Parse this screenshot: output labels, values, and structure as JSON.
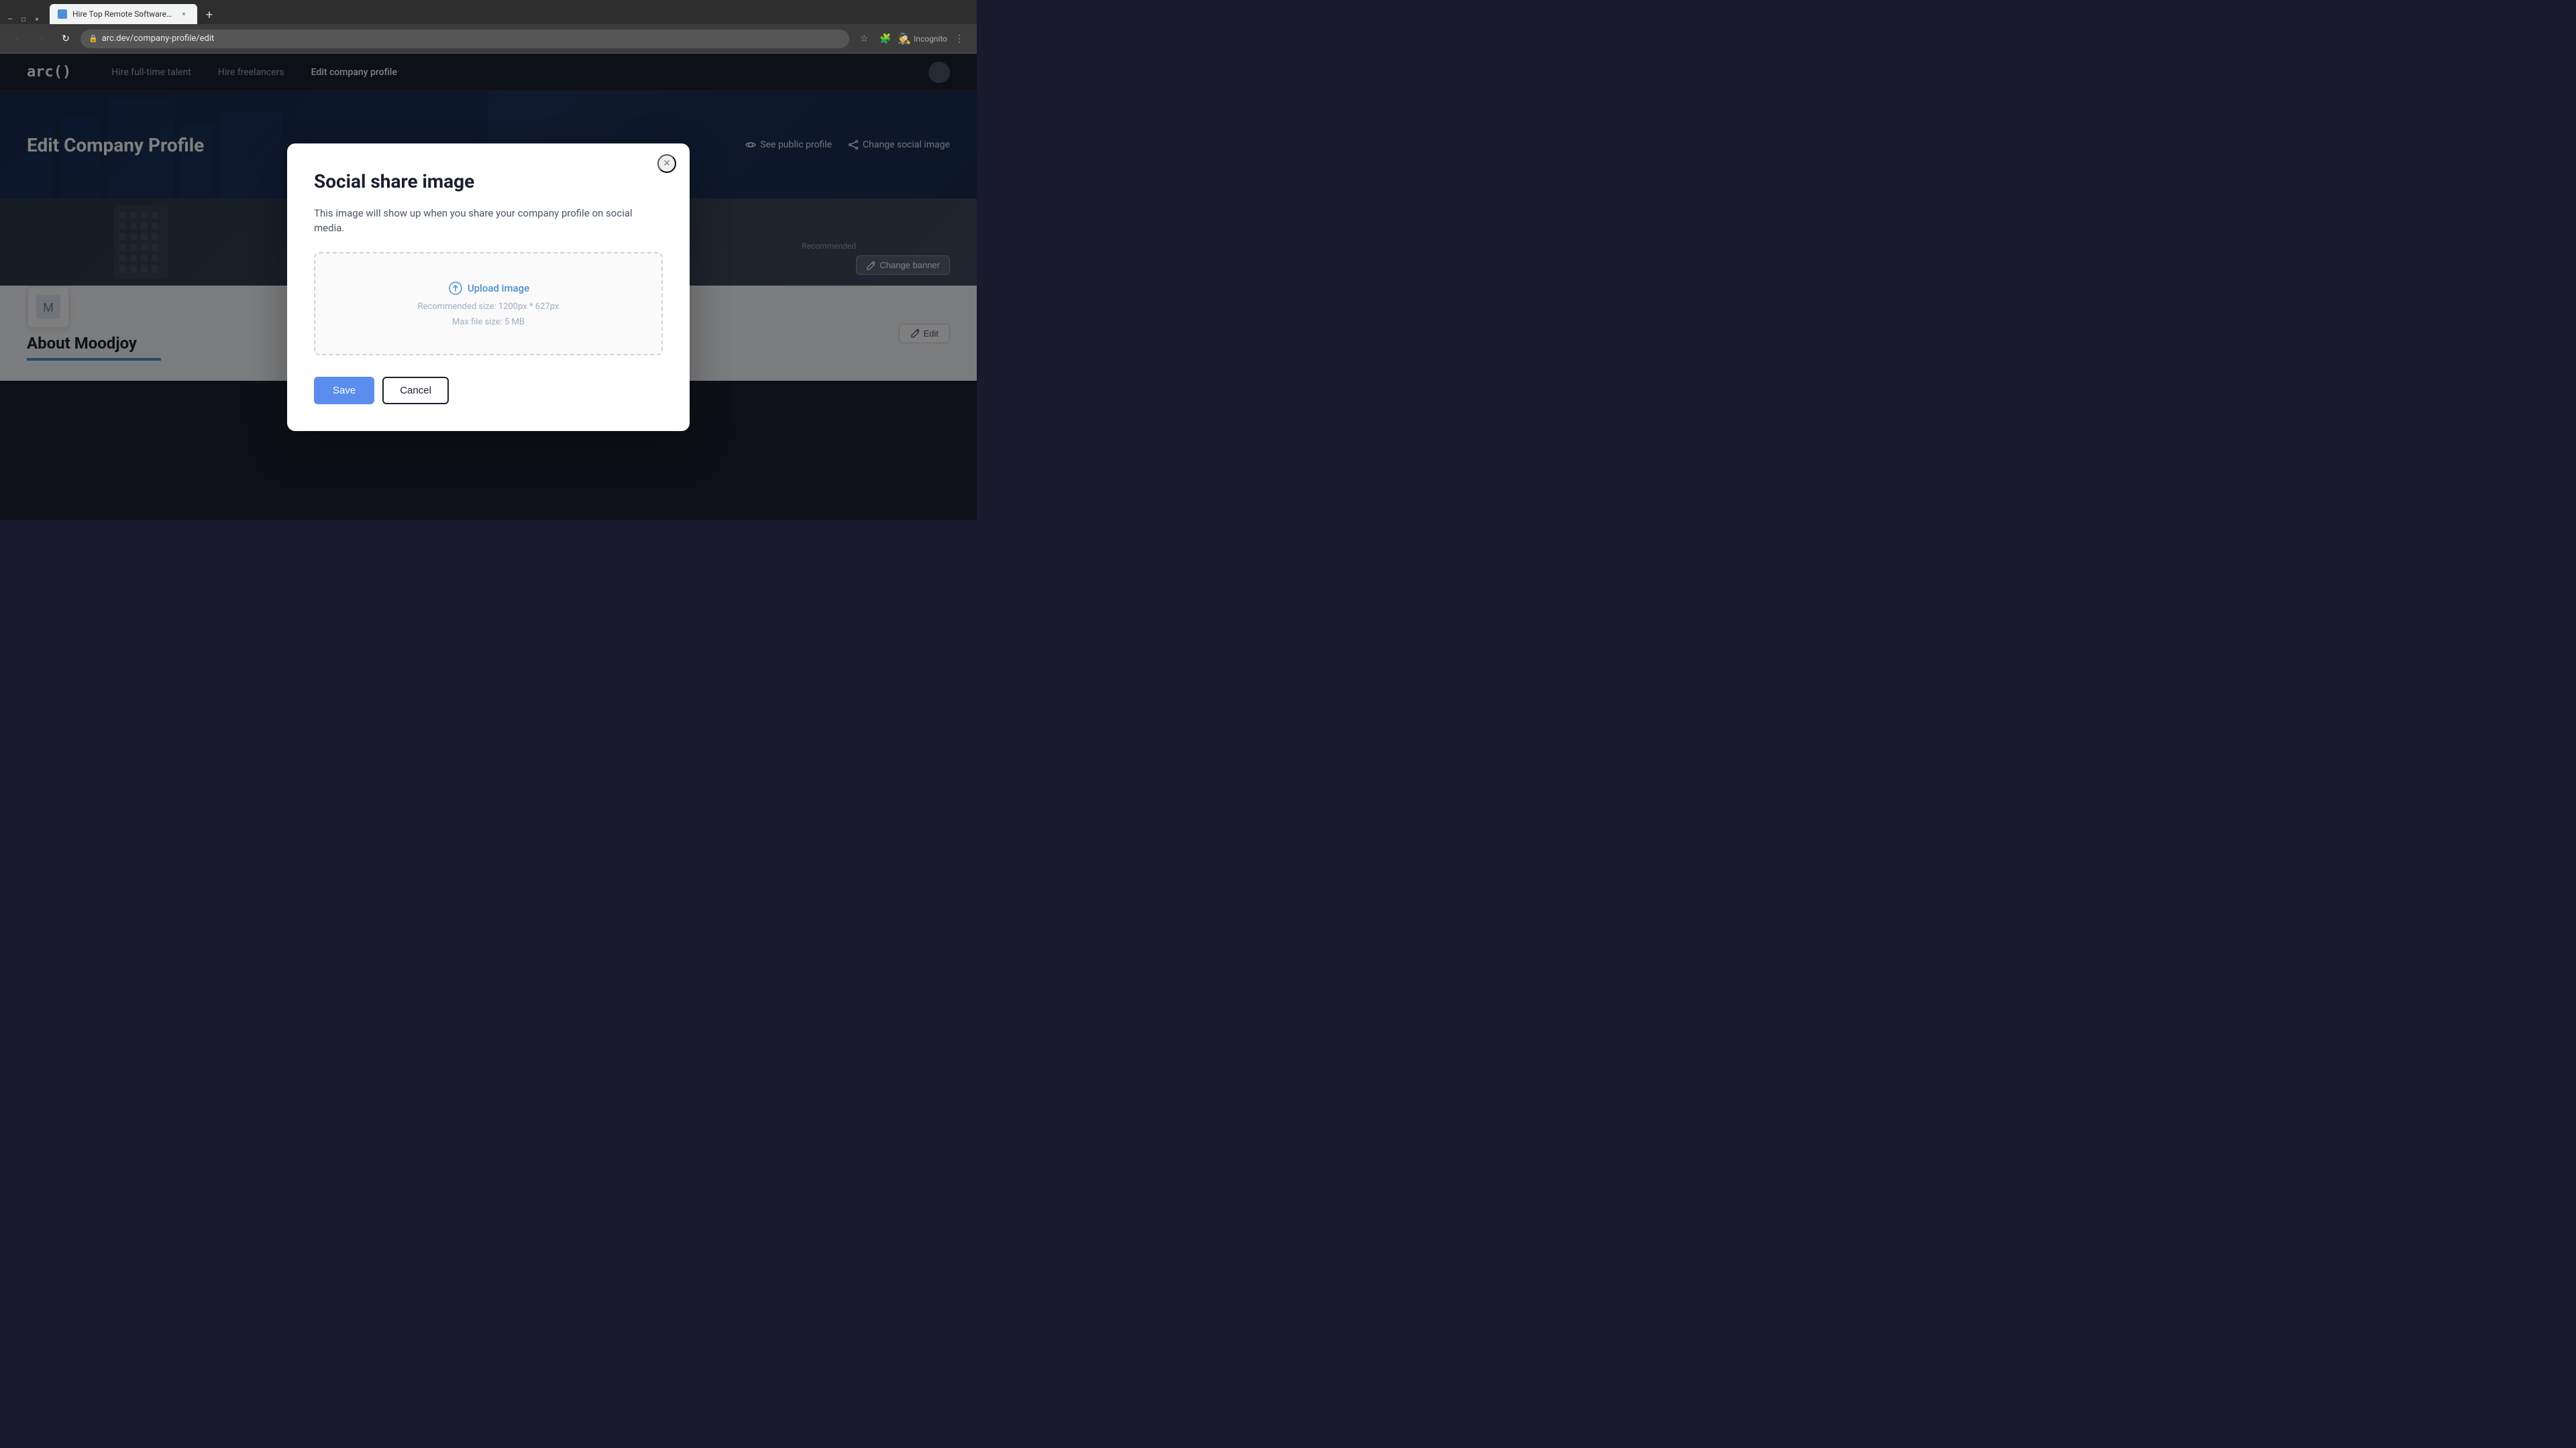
{
  "browser": {
    "tab": {
      "favicon_color": "#4a90d9",
      "title": "Hire Top Remote Software Dev...",
      "close_icon": "×"
    },
    "new_tab_icon": "+",
    "address_bar": {
      "url": "arc.dev/company-profile/edit",
      "lock_icon": "🔒",
      "incognito_label": "Incognito"
    },
    "nav": {
      "back_icon": "‹",
      "forward_icon": "›",
      "reload_icon": "↻"
    },
    "window_controls": {
      "minimize": "—",
      "maximize": "□",
      "close": "×"
    }
  },
  "app": {
    "logo": "arc()",
    "nav_links": [
      {
        "label": "Hire full-time talent",
        "active": false
      },
      {
        "label": "Hire freelancers",
        "active": false
      },
      {
        "label": "Edit company profile",
        "active": true
      }
    ]
  },
  "page": {
    "header": {
      "title": "Edit Company Profile",
      "see_public_profile_label": "See public profile",
      "change_social_image_label": "Change social image"
    },
    "banner": {
      "change_banner_label": "Change banner",
      "recommended_label": "Recommended"
    }
  },
  "about_section": {
    "title": "About Moodjoy",
    "edit_label": "Edit"
  },
  "modal": {
    "title": "Social share image",
    "description": "This image will show up when you share your company profile on social media.",
    "upload_label": "Upload image",
    "recommended_size": "Recommended size: 1200px * 627px",
    "max_file_size": "Max file size: 5 MB",
    "save_label": "Save",
    "cancel_label": "Cancel",
    "close_icon": "×"
  }
}
